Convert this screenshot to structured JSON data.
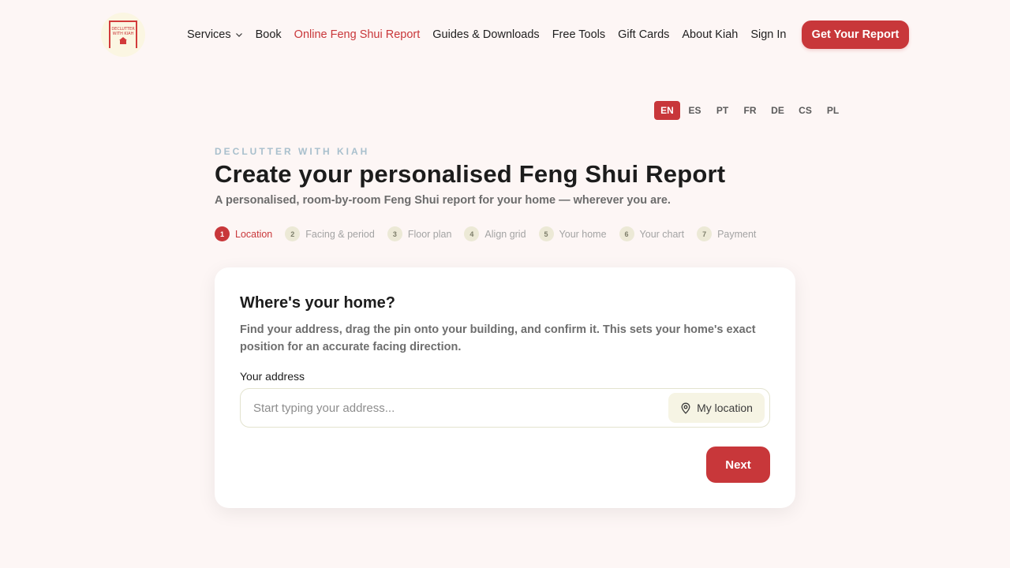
{
  "logo": {
    "text": "DECLUTTER WITH KIAH"
  },
  "nav": {
    "items": [
      {
        "label": "Services",
        "has_dropdown": true,
        "active": false
      },
      {
        "label": "Book",
        "active": false
      },
      {
        "label": "Online Feng Shui Report",
        "active": true
      },
      {
        "label": "Guides & Downloads",
        "active": false
      },
      {
        "label": "Free Tools",
        "active": false
      },
      {
        "label": "Gift Cards",
        "active": false
      },
      {
        "label": "About Kiah",
        "active": false
      },
      {
        "label": "Sign In",
        "active": false
      }
    ],
    "cta_label": "Get Your Report"
  },
  "languages": {
    "items": [
      "EN",
      "ES",
      "PT",
      "FR",
      "DE",
      "CS",
      "PL"
    ],
    "selected": "EN"
  },
  "header": {
    "eyebrow": "DECLUTTER WITH KIAH",
    "title": "Create your personalised Feng Shui Report",
    "subtitle": "A personalised, room-by-room Feng Shui report for your home — wherever you are."
  },
  "steps": [
    {
      "num": "1",
      "label": "Location",
      "active": true
    },
    {
      "num": "2",
      "label": "Facing & period",
      "active": false
    },
    {
      "num": "3",
      "label": "Floor plan",
      "active": false
    },
    {
      "num": "4",
      "label": "Align grid",
      "active": false
    },
    {
      "num": "5",
      "label": "Your home",
      "active": false
    },
    {
      "num": "6",
      "label": "Your chart",
      "active": false
    },
    {
      "num": "7",
      "label": "Payment",
      "active": false
    }
  ],
  "card": {
    "title": "Where's your home?",
    "description": "Find your address, drag the pin onto your building, and confirm it. This sets your home's exact position for an accurate facing direction.",
    "address_label": "Your address",
    "address_value": "",
    "address_placeholder": "Start typing your address...",
    "my_location_label": "My location",
    "next_label": "Next"
  },
  "colors": {
    "accent": "#c8373a",
    "background": "#fdf6f5",
    "eyebrow": "#a9c0cd"
  },
  "icons": {
    "services_dropdown": "chevron-down-icon",
    "my_location": "map-pin-icon",
    "logo": "house-icon"
  }
}
